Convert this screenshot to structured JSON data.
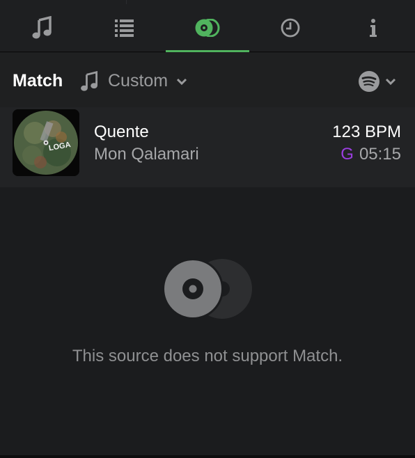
{
  "tabs": [
    {
      "name": "music-note-icon",
      "active": false
    },
    {
      "name": "list-icon",
      "active": false
    },
    {
      "name": "match-icon",
      "active": true
    },
    {
      "name": "clock-icon",
      "active": false
    },
    {
      "name": "info-icon",
      "active": false
    }
  ],
  "colors": {
    "accent": "#50b35e",
    "key_color": "#9a3ee0",
    "background": "#1b1c1e"
  },
  "header": {
    "title": "Match",
    "source_label": "Custom",
    "service_icon": "spotify-icon"
  },
  "track": {
    "title": "Quente",
    "artist": "Mon Qalamari",
    "bpm": "123 BPM",
    "key": "G",
    "duration": "05:15",
    "artwork_text": "LOGA"
  },
  "empty_state": {
    "message": "This source does not support Match."
  }
}
